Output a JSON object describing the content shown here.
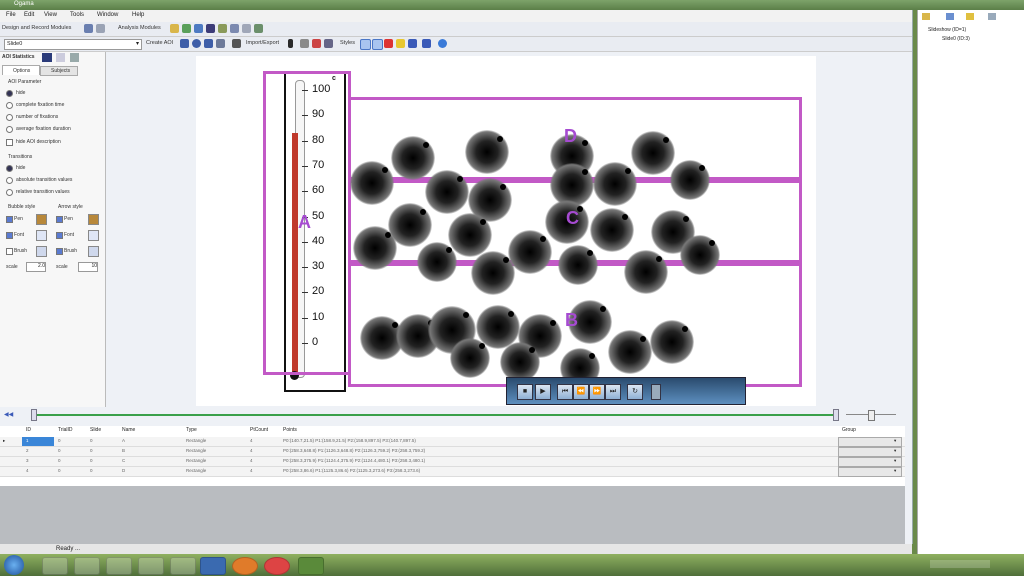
{
  "window": {
    "title": "Ogama"
  },
  "menu": [
    "File",
    "Edit",
    "View",
    "Tools",
    "Window",
    "Help"
  ],
  "toolbar1": {
    "design_label": "Design and Record Modules",
    "analysis_label": "Analysis Modules"
  },
  "toolbar2": {
    "slide_select": "Slide0",
    "create_aoi": "Create AOI",
    "import_export": "Import/Export",
    "styles": "Styles"
  },
  "left_panel": {
    "module_title": "AOI Statistics",
    "tabs": [
      "Options",
      "Subjects"
    ],
    "aoi_params_title": "AOI Parameter",
    "aoi_params": [
      {
        "label": "hide",
        "selected": true
      },
      {
        "label": "complete fixation time",
        "selected": false
      },
      {
        "label": "number of fixations",
        "selected": false
      },
      {
        "label": "average fixation duration",
        "selected": false
      }
    ],
    "hide_aoi_description": "hide AOI description",
    "transitions_title": "Transitions",
    "transitions": [
      {
        "label": "hide",
        "selected": true
      },
      {
        "label": "absolute transition values",
        "selected": false
      },
      {
        "label": "relative transition values",
        "selected": false
      }
    ],
    "bubble_style": "Bubble style",
    "arrow_style": "Arrow style",
    "pen": "Pen",
    "font": "Font",
    "brush": "Brush",
    "scale_label": "scale",
    "bubble_scale": "2.0",
    "arrow_scale": "10"
  },
  "stage": {
    "aoi_labels": [
      "A",
      "B",
      "C",
      "D"
    ],
    "thermometer_ticks": [
      "100",
      "90",
      "80",
      "70",
      "60",
      "50",
      "40",
      "30",
      "20",
      "10",
      "0"
    ],
    "thermometer_level_fraction": 0.83
  },
  "table": {
    "headers": [
      "ID",
      "TrialID",
      "Slide",
      "Name",
      "Type",
      "PtCount",
      "Points",
      "Group"
    ],
    "rows": [
      {
        "id": "1",
        "trial": "0",
        "slide": "0",
        "name": "A",
        "type": "Rectangle",
        "ptcount": "4",
        "points": "P0:(140.7,21.5) P1:(158.9,21.5) P2:(158.9,897.5) P3:(140.7,897.5)"
      },
      {
        "id": "2",
        "trial": "0",
        "slide": "0",
        "name": "B",
        "type": "Rectangle",
        "ptcount": "4",
        "points": "P0:(258.3,648.8) P1:(1126.3,648.8) P2:(1126.3,759.2) P3:(258.3,759.2)"
      },
      {
        "id": "3",
        "trial": "0",
        "slide": "0",
        "name": "C",
        "type": "Rectangle",
        "ptcount": "4",
        "points": "P0:(258.3,375.9) P1:(1124.4,375.9) P2:(1124.4,480.1) P3:(258.3,480.1)"
      },
      {
        "id": "4",
        "trial": "0",
        "slide": "0",
        "name": "D",
        "type": "Rectangle",
        "ptcount": "4",
        "points": "P0:(258.3,86.6) P1:(1125.3,86.6) P2:(1125.3,273.6) P3:(258.3,273.6)"
      }
    ]
  },
  "status": {
    "text": "Ready ..."
  },
  "right_panel": {
    "tree_root": "Slideshow (ID=1)",
    "tree_child": "Slide0 (ID:3)"
  },
  "colors": {
    "aoi": "#c259c6",
    "aoi_label": "#a64bd1",
    "mercury": "#c0392b"
  }
}
